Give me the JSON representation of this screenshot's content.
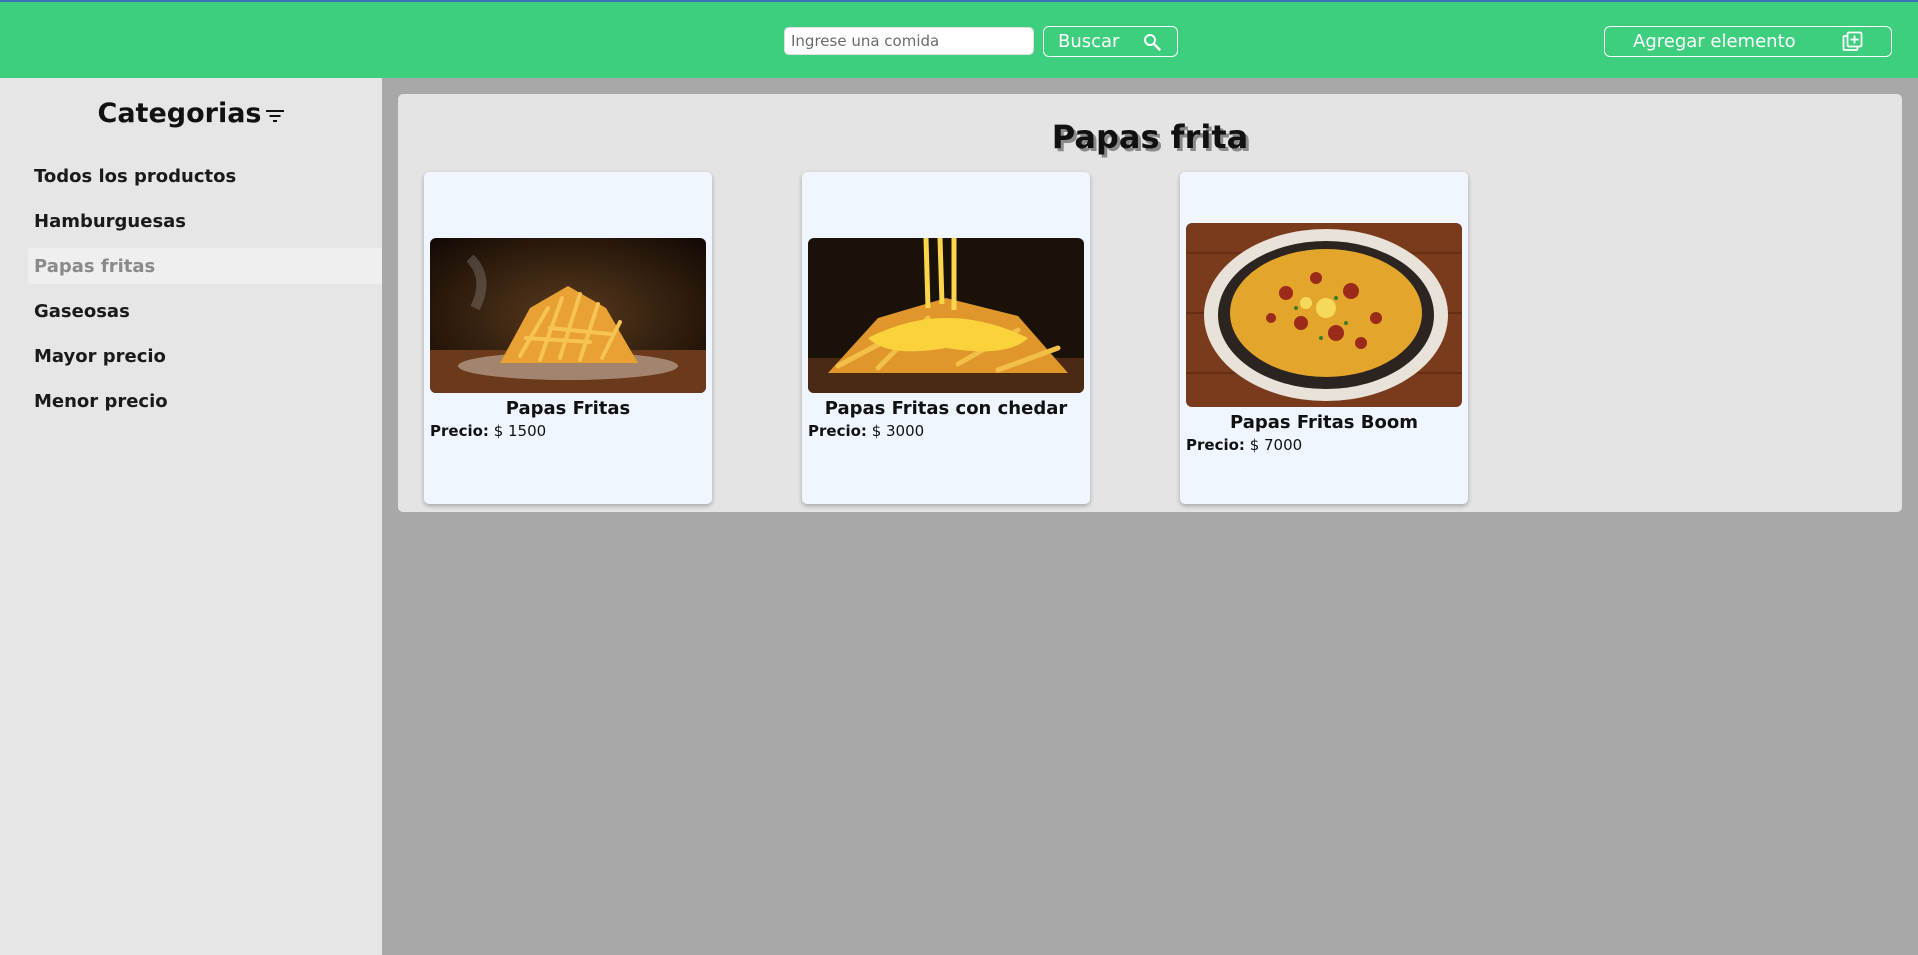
{
  "header": {
    "search": {
      "placeholder": "Ingrese una comida",
      "value": ""
    },
    "search_button_label": "Buscar",
    "search_icon": "search-icon",
    "add_button_label": "Agregar elemento",
    "add_icon": "add-box-icon",
    "bg_color": "#3ecf7e"
  },
  "sidebar": {
    "title": "Categorias",
    "title_icon": "filter-icon",
    "items": [
      {
        "label": "Todos los productos",
        "active": false
      },
      {
        "label": "Hamburguesas",
        "active": false
      },
      {
        "label": "Papas fritas",
        "active": true
      },
      {
        "label": "Gaseosas",
        "active": false
      },
      {
        "label": "Mayor precio",
        "active": false
      },
      {
        "label": "Menor precio",
        "active": false
      }
    ]
  },
  "main": {
    "title": "Papas frita",
    "price_label": "Precio:",
    "products": [
      {
        "name": "Papas Fritas",
        "price": "$ 1500",
        "image": "fries-photo"
      },
      {
        "name": "Papas Fritas con chedar",
        "price": "$ 3000",
        "image": "cheddar-fries-photo"
      },
      {
        "name": "Papas Fritas Boom",
        "price": "$ 7000",
        "image": "loaded-fries-photo"
      }
    ]
  }
}
